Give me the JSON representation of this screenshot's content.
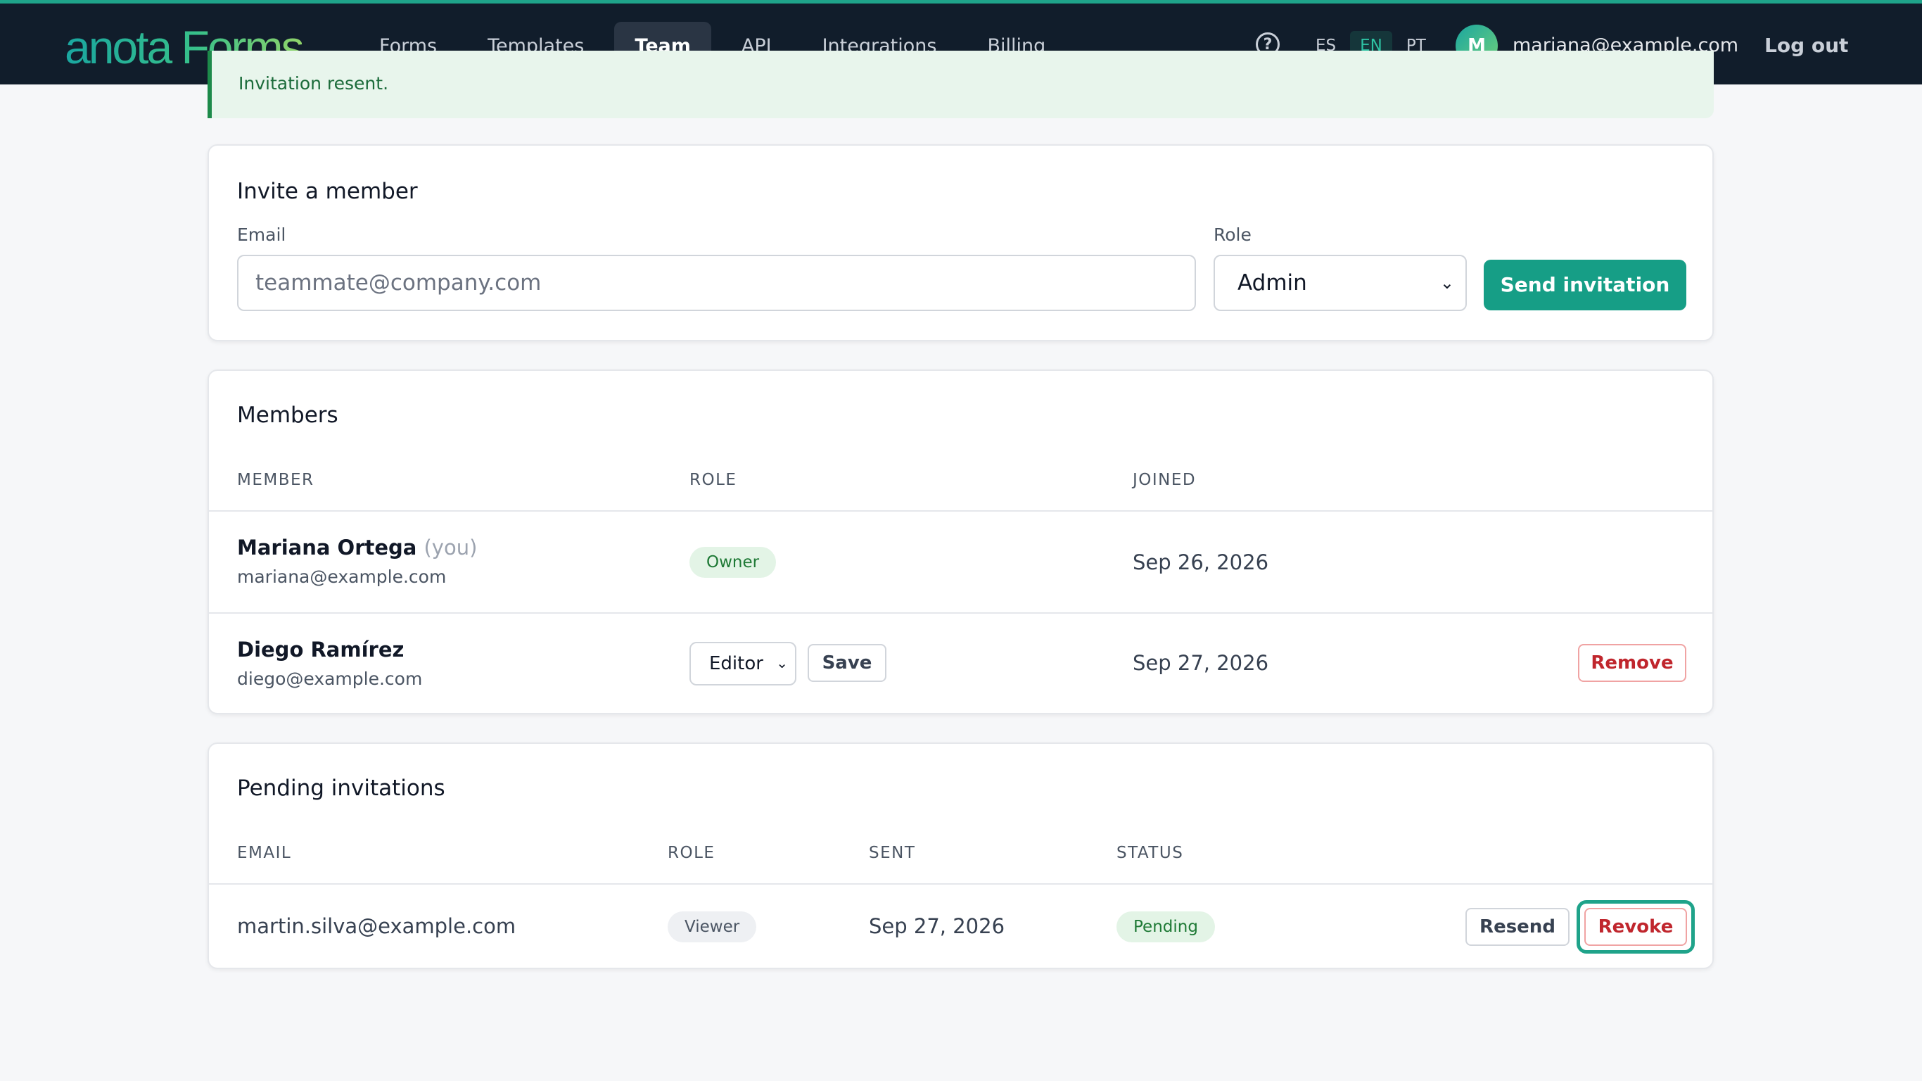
{
  "brand": {
    "name": "anota Forms"
  },
  "nav": {
    "items": [
      "Forms",
      "Templates",
      "Team",
      "API",
      "Integrations",
      "Billing"
    ],
    "active": "Team"
  },
  "header": {
    "help_icon": "question-circle-icon",
    "languages": [
      "ES",
      "EN",
      "PT"
    ],
    "active_language": "EN",
    "avatar_initial": "M",
    "user_email": "mariana@example.com",
    "logout_label": "Log out"
  },
  "flash": {
    "message": "Invitation resent."
  },
  "invite": {
    "title": "Invite a member",
    "email_label": "Email",
    "email_placeholder": "teammate@company.com",
    "role_label": "Role",
    "role_value": "Admin",
    "submit_label": "Send invitation"
  },
  "members": {
    "title": "Members",
    "columns": [
      "MEMBER",
      "ROLE",
      "JOINED"
    ],
    "rows": [
      {
        "name": "Mariana Ortega",
        "you": "(you)",
        "email": "mariana@example.com",
        "role": "Owner",
        "joined": "Sep 26, 2026"
      },
      {
        "name": "Diego Ramírez",
        "email": "diego@example.com",
        "role": "Editor",
        "save_label": "Save",
        "joined": "Sep 27, 2026",
        "remove_label": "Remove"
      }
    ]
  },
  "invitations": {
    "title": "Pending invitations",
    "columns": [
      "EMAIL",
      "ROLE",
      "SENT",
      "STATUS"
    ],
    "rows": [
      {
        "email": "martin.silva@example.com",
        "role": "Viewer",
        "sent": "Sep 27, 2026",
        "status": "Pending",
        "resend_label": "Resend",
        "revoke_label": "Revoke"
      }
    ]
  },
  "colors": {
    "accent": "#169e86",
    "topbar": "#111d2b",
    "danger": "#c0262d",
    "success_badge": "#e3f4e6"
  }
}
